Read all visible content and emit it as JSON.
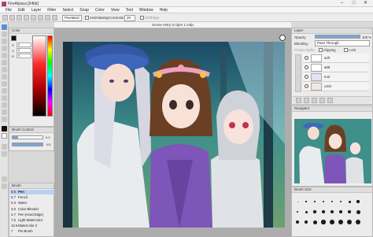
{
  "app": {
    "title": "FireAlpaca [64bit]"
  },
  "menu": [
    "File",
    "Edit",
    "Layer",
    "Filter",
    "Select",
    "Snap",
    "Color",
    "View",
    "Tool",
    "Window",
    "Help"
  ],
  "toolbar": {
    "interp": "Pixelated",
    "antialias": "AntiAliasing",
    "correction_label": "Correction",
    "correction": "20",
    "selfedge": "SelfEdge"
  },
  "color_panel": {
    "title": "Color",
    "r": "0",
    "g": "0",
    "b": "0",
    "r_label": "R",
    "g_label": "G",
    "b_label": "B",
    "current_color": "#1a0a0a"
  },
  "brush_control": {
    "title": "Brush Control",
    "size": "6.5",
    "opacity": "100",
    "opacity_pct": 1.0
  },
  "brush_panel": {
    "title": "Brush",
    "items": [
      {
        "size": "6.5",
        "name": "Pen"
      },
      {
        "size": "5.7",
        "name": "Pencil"
      },
      {
        "size": "5.0",
        "name": "Water"
      },
      {
        "size": "3.0",
        "name": "Color Blender"
      },
      {
        "size": "4.7",
        "name": "Pen (Hard Edge)"
      },
      {
        "size": "7.5",
        "name": "Light Watercolor"
      },
      {
        "size": "12.5",
        "name": "Watercolor 2"
      },
      {
        "size": "7",
        "name": "Pin Brush"
      }
    ]
  },
  "canvas": {
    "tab_title": "Scene entry to bpm 1.mdp"
  },
  "layer_panel": {
    "title": "Layer",
    "opacity_label": "Opacity",
    "opacity_value": "100 %",
    "opacity_pct": 1.0,
    "blending_label": "Blending",
    "blending_value": "Pass Through",
    "protect_alpha": "Protect Alpha",
    "clipping": "Clipping",
    "lock": "Lock",
    "layers": [
      {
        "name": "soft"
      },
      {
        "name": "add"
      },
      {
        "name": "mul"
      },
      {
        "name": "color"
      }
    ]
  },
  "navigator": {
    "title": "Navigator"
  },
  "brush_size": {
    "title": "Brush Size"
  },
  "colors": {
    "accent": "#7aa6d8",
    "panel": "#ececec",
    "header": "#dedede"
  }
}
